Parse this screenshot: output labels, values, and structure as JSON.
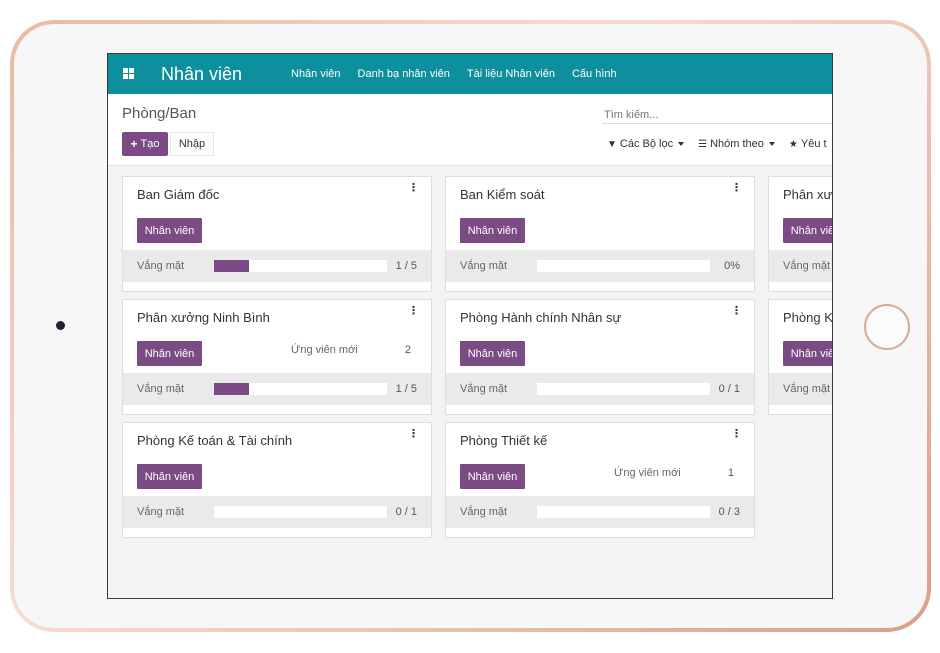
{
  "app": {
    "title": "Nhân viên",
    "menu": [
      "Nhân viên",
      "Danh bạ nhân viên",
      "Tài liệu Nhân viên",
      "Cấu hình"
    ]
  },
  "control": {
    "breadcrumb": "Phòng/Ban",
    "create_label": "Tạo",
    "import_label": "Nhập",
    "search_placeholder": "Tìm kiếm...",
    "filters_label": "Các Bộ lọc",
    "group_by_label": "Nhóm theo",
    "favorites_label": "Yêu t"
  },
  "card_labels": {
    "employees_button": "Nhân viên",
    "absent": "Vắng mặt",
    "new_applicants": "Ứng viên mới",
    "menu_icon": "⋮"
  },
  "colors": {
    "navbar": "#0e8f9e",
    "accent": "#7c4a85"
  },
  "cards": [
    {
      "title": "Ban Giám đốc",
      "absence_text": "1 / 5",
      "absence_fraction": 0.2,
      "new_applicants": null
    },
    {
      "title": "Ban Kiểm soát",
      "absence_text": "0%",
      "absence_fraction": 0,
      "new_applicants": null
    },
    {
      "title": "Phân xư",
      "absence_text": "",
      "absence_fraction": 0,
      "new_applicants": null
    },
    {
      "title": "Phân xưởng Ninh Bình",
      "absence_text": "1 / 5",
      "absence_fraction": 0.2,
      "new_applicants": "2"
    },
    {
      "title": "Phòng Hành chính Nhân sự",
      "absence_text": "0 / 1",
      "absence_fraction": 0,
      "new_applicants": null
    },
    {
      "title": "Phòng K",
      "absence_text": "",
      "absence_fraction": 0,
      "new_applicants": null
    },
    {
      "title": "Phòng Kế toán & Tài chính",
      "absence_text": "0 / 1",
      "absence_fraction": 0,
      "new_applicants": null
    },
    {
      "title": "Phòng Thiết kế",
      "absence_text": "0 / 3",
      "absence_fraction": 0,
      "new_applicants": "1"
    }
  ]
}
